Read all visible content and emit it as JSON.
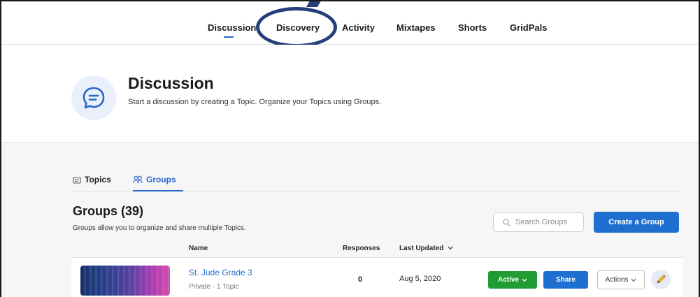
{
  "nav": {
    "items": [
      "Discussion",
      "Discovery",
      "Activity",
      "Mixtapes",
      "Shorts",
      "GridPals"
    ]
  },
  "header": {
    "icon": "chat-bubble-icon",
    "title": "Discussion",
    "subtitle": "Start a discussion by creating a Topic. Organize your Topics using Groups."
  },
  "tabs": {
    "topics": {
      "label": "Topics",
      "icon": "topics-icon"
    },
    "groups": {
      "label": "Groups",
      "icon": "groups-icon"
    }
  },
  "groups": {
    "title": "Groups (39)",
    "description": "Groups allow you to organize and share multiple Topics.",
    "search_placeholder": "Search Groups",
    "create_label": "Create a Group",
    "columns": {
      "name": "Name",
      "responses": "Responses",
      "last_updated": "Last Updated"
    },
    "rows": [
      {
        "name": "St. Jude Grade 3",
        "meta": "Private · 1 Topic",
        "responses": "0",
        "last_updated": "Aug 5, 2020",
        "status_label": "Active",
        "share_label": "Share",
        "actions_label": "Actions"
      }
    ]
  },
  "colors": {
    "accent": "#1f6fd1",
    "active": "#1f9c33",
    "annotation": "#243f7a"
  }
}
